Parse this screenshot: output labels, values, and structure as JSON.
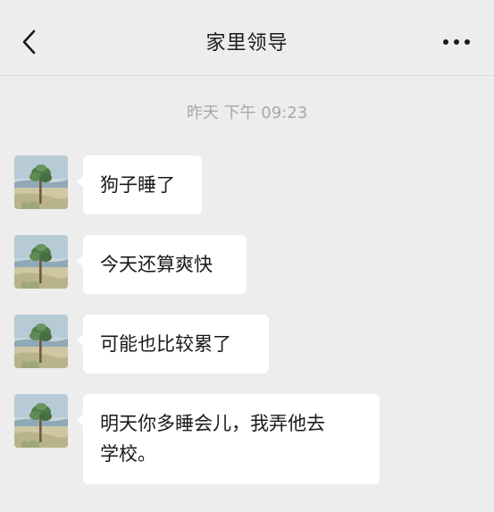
{
  "header": {
    "title": "家里领导",
    "back_icon": "chevron-left-icon",
    "more_icon": "more-horizontal-icon"
  },
  "chat": {
    "timestamp": "昨天 下午 09:23",
    "messages": [
      {
        "text": "狗子睡了"
      },
      {
        "text": "今天还算爽快"
      },
      {
        "text": "可能也比较累了"
      },
      {
        "text": "明天你多睡会儿，我弄他去\n学校。"
      }
    ]
  },
  "colors": {
    "background": "#ededed",
    "bubble": "#ffffff",
    "timestamp": "#a8a8a8",
    "text": "#1a1a1a"
  }
}
